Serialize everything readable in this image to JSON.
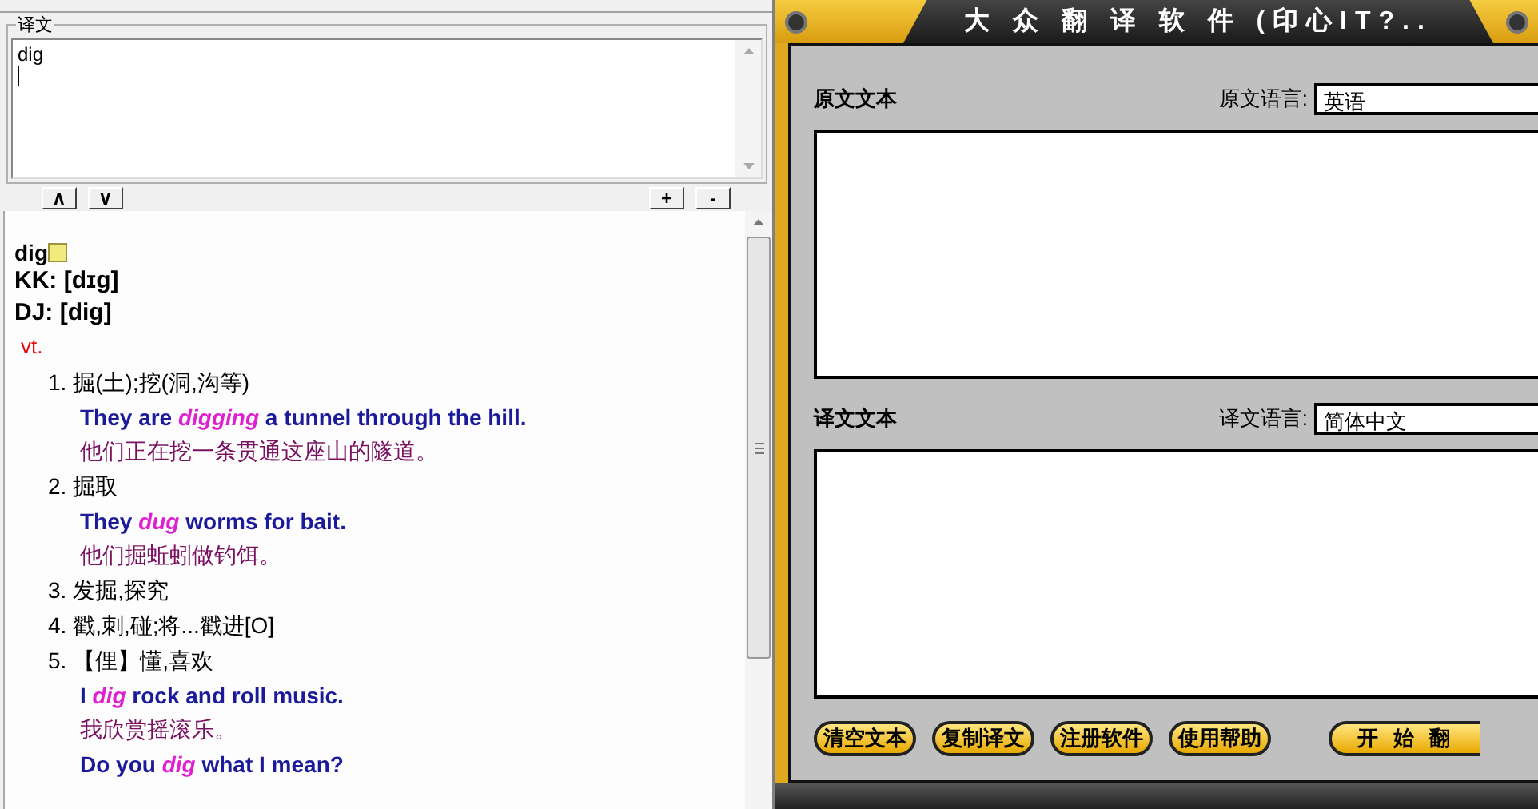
{
  "left": {
    "group_label": "译文",
    "input": {
      "value": "dig"
    },
    "nav_buttons": [
      "∧",
      "∨"
    ],
    "zoom_buttons": [
      "+",
      "-"
    ]
  },
  "entry": {
    "headword": "dig",
    "kk": "KK: [dɪg]",
    "dj": "DJ: [dig]",
    "pos": "vt.",
    "senses": [
      {
        "number": "1.",
        "text": "掘(土);挖(洞,沟等)",
        "examples": [
          {
            "en": "They are *digging* a tunnel through the hill.",
            "zh": "他们正在挖一条贯通这座山的隧道。"
          }
        ]
      },
      {
        "number": "2.",
        "text": "掘取",
        "examples": [
          {
            "en": "They *dug* worms for bait.",
            "zh": "他们掘蚯蚓做钓饵。"
          }
        ]
      },
      {
        "number": "3.",
        "text": "发掘,探究"
      },
      {
        "number": "4.",
        "text": "戳,刺,碰;将...戳进[O]"
      },
      {
        "number": "5.",
        "text": "【俚】懂,喜欢",
        "examples": [
          {
            "en": "I *dig* rock and roll music.",
            "zh": "我欣赏摇滚乐。"
          },
          {
            "en": "Do you *dig* what I mean?"
          }
        ]
      }
    ]
  },
  "app": {
    "title": "大 众 翻 译 软 件 (印心IT?..",
    "source": {
      "label": "原文文本",
      "lang_label": "原文语言:",
      "lang_value": "英语"
    },
    "target": {
      "label": "译文文本",
      "lang_label": "译文语言:",
      "lang_value": "简体中文"
    },
    "buttons": [
      "清空文本",
      "复制译文",
      "注册软件",
      "使用帮助"
    ],
    "start_button": "开 始 翻"
  }
}
